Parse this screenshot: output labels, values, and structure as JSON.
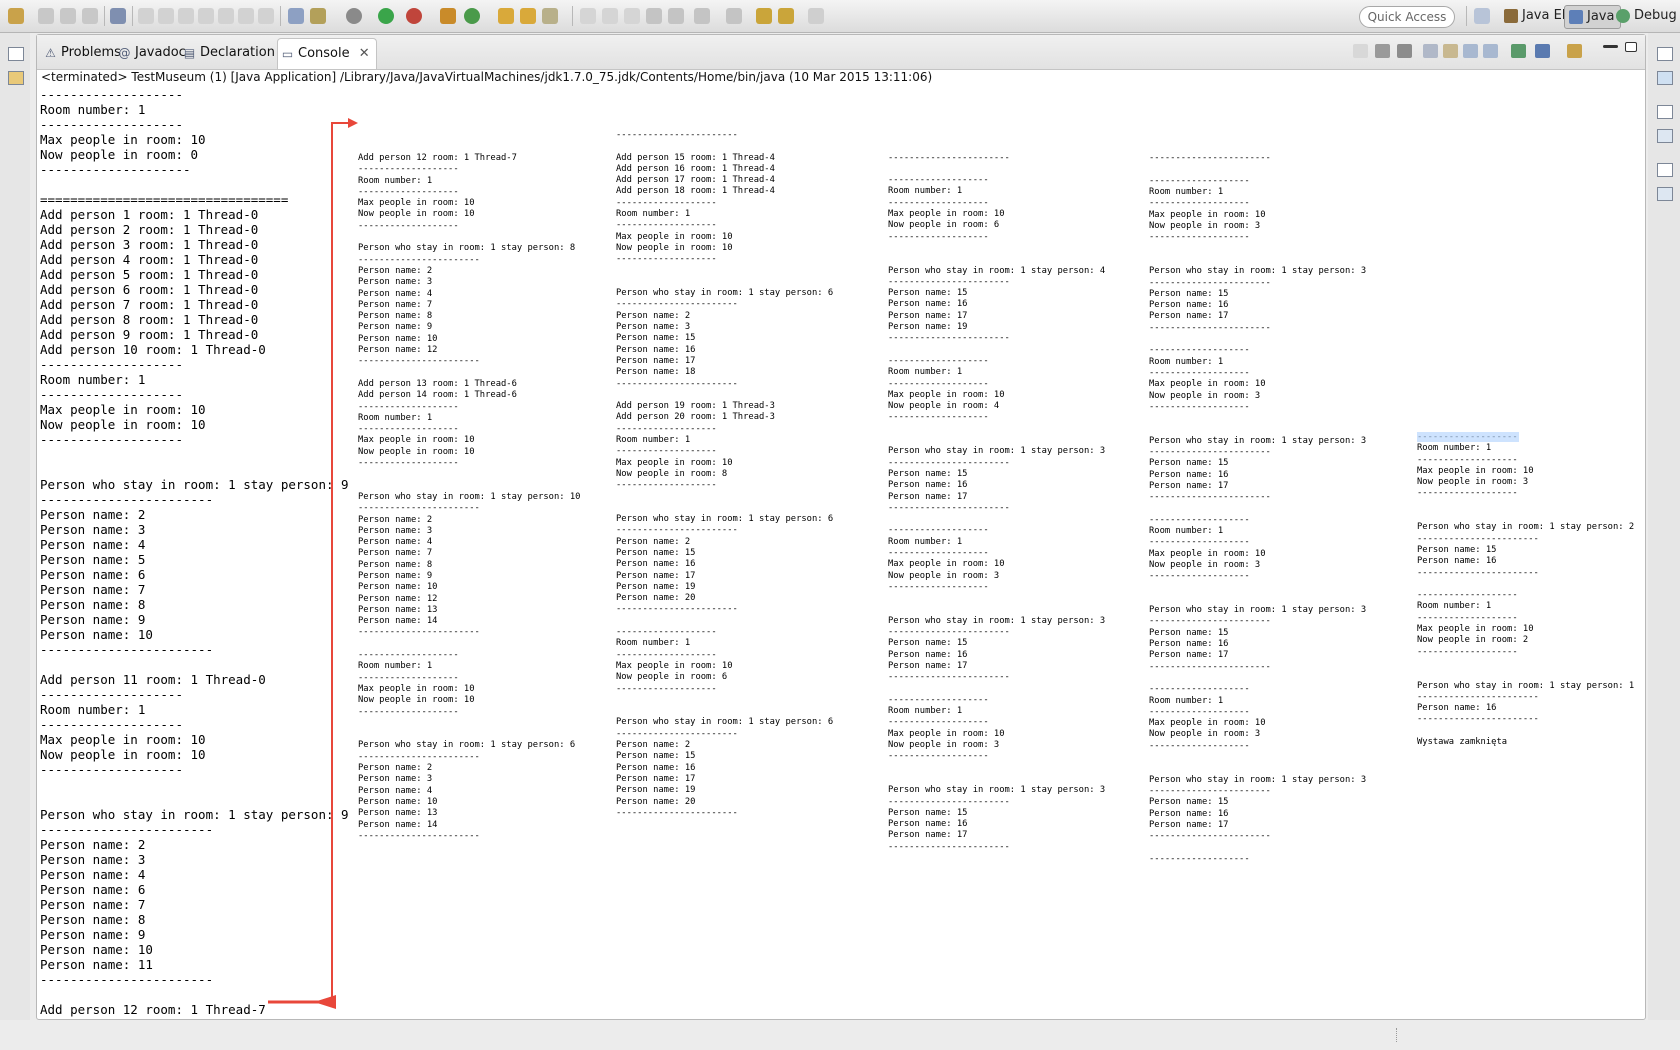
{
  "toolbar": {
    "quick_access_placeholder": "Quick Access",
    "perspectives": [
      "Java EE",
      "Java",
      "Debug"
    ]
  },
  "view": {
    "tabs": [
      {
        "label": "Problems",
        "icon": "problems-icon"
      },
      {
        "label": "Javadoc",
        "icon": "javadoc-icon"
      },
      {
        "label": "Declaration",
        "icon": "declaration-icon"
      },
      {
        "label": "Console",
        "icon": "console-icon"
      }
    ],
    "active_tab": "Console",
    "process_line": "<terminated> TestMuseum (1) [Java Application] /Library/Java/JavaVirtualMachines/jdk1.7.0_75.jdk/Contents/Home/bin/java (10 Mar 2015 13:11:06)"
  },
  "console": {
    "main_output": "-------------------\nRoom number: 1\n-------------------\nMax people in room: 10\nNow people in room: 0\n--------------------\n\n=================================\nAdd person 1 room: 1 Thread-0\nAdd person 2 room: 1 Thread-0\nAdd person 3 room: 1 Thread-0\nAdd person 4 room: 1 Thread-0\nAdd person 5 room: 1 Thread-0\nAdd person 6 room: 1 Thread-0\nAdd person 7 room: 1 Thread-0\nAdd person 8 room: 1 Thread-0\nAdd person 9 room: 1 Thread-0\nAdd person 10 room: 1 Thread-0\n-------------------\nRoom number: 1\n-------------------\nMax people in room: 10\nNow people in room: 10\n-------------------\n\n\nPerson who stay in room: 1 stay person: 9\n-----------------------\nPerson name: 2\nPerson name: 3\nPerson name: 4\nPerson name: 5\nPerson name: 6\nPerson name: 7\nPerson name: 8\nPerson name: 9\nPerson name: 10\n-----------------------\n\nAdd person 11 room: 1 Thread-0\n-------------------\nRoom number: 1\n-------------------\nMax people in room: 10\nNow people in room: 10\n-------------------\n\n\nPerson who stay in room: 1 stay person: 9\n-----------------------\nPerson name: 2\nPerson name: 3\nPerson name: 4\nPerson name: 6\nPerson name: 7\nPerson name: 8\nPerson name: 9\nPerson name: 10\nPerson name: 11\n-----------------------\n\nAdd person 12 room: 1 Thread-7",
    "continuation_columns": [
      "Add person 12 room: 1 Thread-7\n-------------------\nRoom number: 1\n-------------------\nMax people in room: 10\nNow people in room: 10\n-------------------\n\nPerson who stay in room: 1 stay person: 8\n-----------------------\nPerson name: 2\nPerson name: 3\nPerson name: 4\nPerson name: 7\nPerson name: 8\nPerson name: 9\nPerson name: 10\nPerson name: 12\n-----------------------\n\nAdd person 13 room: 1 Thread-6\nAdd person 14 room: 1 Thread-6\n-------------------\nRoom number: 1\n-------------------\nMax people in room: 10\nNow people in room: 10\n-------------------\n\n\nPerson who stay in room: 1 stay person: 10\n-----------------------\nPerson name: 2\nPerson name: 3\nPerson name: 4\nPerson name: 7\nPerson name: 8\nPerson name: 9\nPerson name: 10\nPerson name: 12\nPerson name: 13\nPerson name: 14\n-----------------------\n\n-------------------\nRoom number: 1\n-------------------\nMax people in room: 10\nNow people in room: 10\n-------------------\n\n\nPerson who stay in room: 1 stay person: 6\n-----------------------\nPerson name: 2\nPerson name: 3\nPerson name: 4\nPerson name: 10\nPerson name: 13\nPerson name: 14\n-----------------------",
      "-----------------------\n\nAdd person 15 room: 1 Thread-4\nAdd person 16 room: 1 Thread-4\nAdd person 17 room: 1 Thread-4\nAdd person 18 room: 1 Thread-4\n-------------------\nRoom number: 1\n-------------------\nMax people in room: 10\nNow people in room: 10\n-------------------\n\n\nPerson who stay in room: 1 stay person: 6\n-----------------------\nPerson name: 2\nPerson name: 3\nPerson name: 15\nPerson name: 16\nPerson name: 17\nPerson name: 18\n-----------------------\n\nAdd person 19 room: 1 Thread-3\nAdd person 20 room: 1 Thread-3\n-------------------\nRoom number: 1\n-------------------\nMax people in room: 10\nNow people in room: 8\n-------------------\n\n\nPerson who stay in room: 1 stay person: 6\n-----------------------\nPerson name: 2\nPerson name: 15\nPerson name: 16\nPerson name: 17\nPerson name: 19\nPerson name: 20\n-----------------------\n\n-------------------\nRoom number: 1\n-------------------\nMax people in room: 10\nNow people in room: 6\n-------------------\n\n\nPerson who stay in room: 1 stay person: 6\n-----------------------\nPerson name: 2\nPerson name: 15\nPerson name: 16\nPerson name: 17\nPerson name: 19\nPerson name: 20\n-----------------------",
      "\n\n-----------------------\n\n-------------------\nRoom number: 1\n-------------------\nMax people in room: 10\nNow people in room: 6\n-------------------\n\n\nPerson who stay in room: 1 stay person: 4\n-----------------------\nPerson name: 15\nPerson name: 16\nPerson name: 17\nPerson name: 19\n-----------------------\n\n-------------------\nRoom number: 1\n-------------------\nMax people in room: 10\nNow people in room: 4\n-------------------\n\n\nPerson who stay in room: 1 stay person: 3\n-----------------------\nPerson name: 15\nPerson name: 16\nPerson name: 17\n-----------------------\n\n-------------------\nRoom number: 1\n-------------------\nMax people in room: 10\nNow people in room: 3\n-------------------\n\n\nPerson who stay in room: 1 stay person: 3\n-----------------------\nPerson name: 15\nPerson name: 16\nPerson name: 17\n-----------------------\n\n-------------------\nRoom number: 1\n-------------------\nMax people in room: 10\nNow people in room: 3\n-------------------\n\n\nPerson who stay in room: 1 stay person: 3\n-----------------------\nPerson name: 15\nPerson name: 16\nPerson name: 17\n-----------------------",
      "\n-----------------------\n\n-------------------\nRoom number: 1\n-------------------\nMax people in room: 10\nNow people in room: 3\n-------------------\n\n\nPerson who stay in room: 1 stay person: 3\n-----------------------\nPerson name: 15\nPerson name: 16\nPerson name: 17\n-----------------------\n\n-------------------\nRoom number: 1\n-------------------\nMax people in room: 10\nNow people in room: 3\n-------------------\n\n\nPerson who stay in room: 1 stay person: 3\n-----------------------\nPerson name: 15\nPerson name: 16\nPerson name: 17\n-----------------------\n\n-------------------\nRoom number: 1\n-------------------\nMax people in room: 10\nNow people in room: 3\n-------------------\n\n\nPerson who stay in room: 1 stay person: 3\n-----------------------\nPerson name: 15\nPerson name: 16\nPerson name: 17\n-----------------------\n\n-------------------\nRoom number: 1\n-------------------\nMax people in room: 10\nNow people in room: 3\n-------------------\n\n\nPerson who stay in room: 1 stay person: 3\n-----------------------\nPerson name: 15\nPerson name: 16\nPerson name: 17\n-----------------------\n\n-------------------",
      "-------------------\nRoom number: 1\n-------------------\nMax people in room: 10\nNow people in room: 3\n-------------------\n\n\nPerson who stay in room: 1 stay person: 2\n-----------------------\nPerson name: 15\nPerson name: 16\n-----------------------\n\n-------------------\nRoom number: 1\n-------------------\nMax people in room: 10\nNow people in room: 2\n-------------------\n\n\nPerson who stay in room: 1 stay person: 1\n-----------------------\nPerson name: 16\n-----------------------\n\nWystawa zamknięta"
    ]
  },
  "colors": {
    "annotation_arrow": "#e8473a",
    "selection": "#b3d4fd"
  }
}
